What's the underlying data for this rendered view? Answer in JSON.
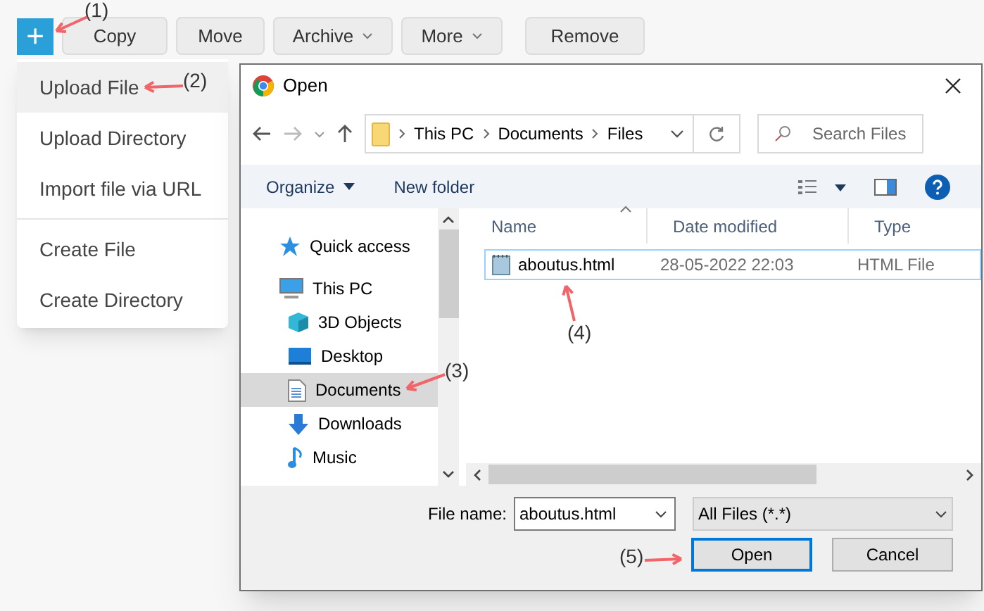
{
  "toolbar": {
    "add_button": "+",
    "buttons": [
      {
        "label": "Copy",
        "dropdown": false
      },
      {
        "label": "Move",
        "dropdown": false
      },
      {
        "label": "Archive",
        "dropdown": true
      },
      {
        "label": "More",
        "dropdown": true
      },
      {
        "label": "Remove",
        "dropdown": false
      }
    ]
  },
  "menu": {
    "groups": [
      [
        {
          "label": "Upload File",
          "selected": true
        },
        {
          "label": "Upload Directory",
          "selected": false
        },
        {
          "label": "Import file via URL",
          "selected": false
        }
      ],
      [
        {
          "label": "Create File",
          "selected": false
        },
        {
          "label": "Create Directory",
          "selected": false
        }
      ]
    ]
  },
  "dialog": {
    "title": "Open",
    "path": [
      "This PC",
      "Documents",
      "Files"
    ],
    "search": {
      "placeholder": "Search Files"
    },
    "commands": [
      {
        "label": "Organize",
        "dropdown": true
      },
      {
        "label": "New folder",
        "dropdown": false
      }
    ],
    "nav": [
      {
        "label": "Quick access",
        "kind": "star",
        "selected": false
      },
      {
        "label": "This PC",
        "kind": "pc",
        "selected": false,
        "children": [
          {
            "label": "3D Objects",
            "kind": "cube",
            "selected": false
          },
          {
            "label": "Desktop",
            "kind": "desktop",
            "selected": false
          },
          {
            "label": "Documents",
            "kind": "document",
            "selected": true
          },
          {
            "label": "Downloads",
            "kind": "download",
            "selected": false
          },
          {
            "label": "Music",
            "kind": "music",
            "selected": false
          }
        ]
      }
    ],
    "columns": [
      "Name",
      "Date modified",
      "Type"
    ],
    "files": [
      {
        "name": "aboutus.html",
        "date": "28-05-2022 22:03",
        "type": "HTML File",
        "selected": true
      }
    ],
    "file_name_label": "File name:",
    "file_name": "aboutus.html",
    "file_type": "All Files (*.*)",
    "buttons": [
      {
        "label": "Open",
        "default": true
      },
      {
        "label": "Cancel",
        "default": false
      }
    ]
  },
  "annotations": [
    "(1)",
    "(2)",
    "(3)",
    "(4)",
    "(5)"
  ]
}
